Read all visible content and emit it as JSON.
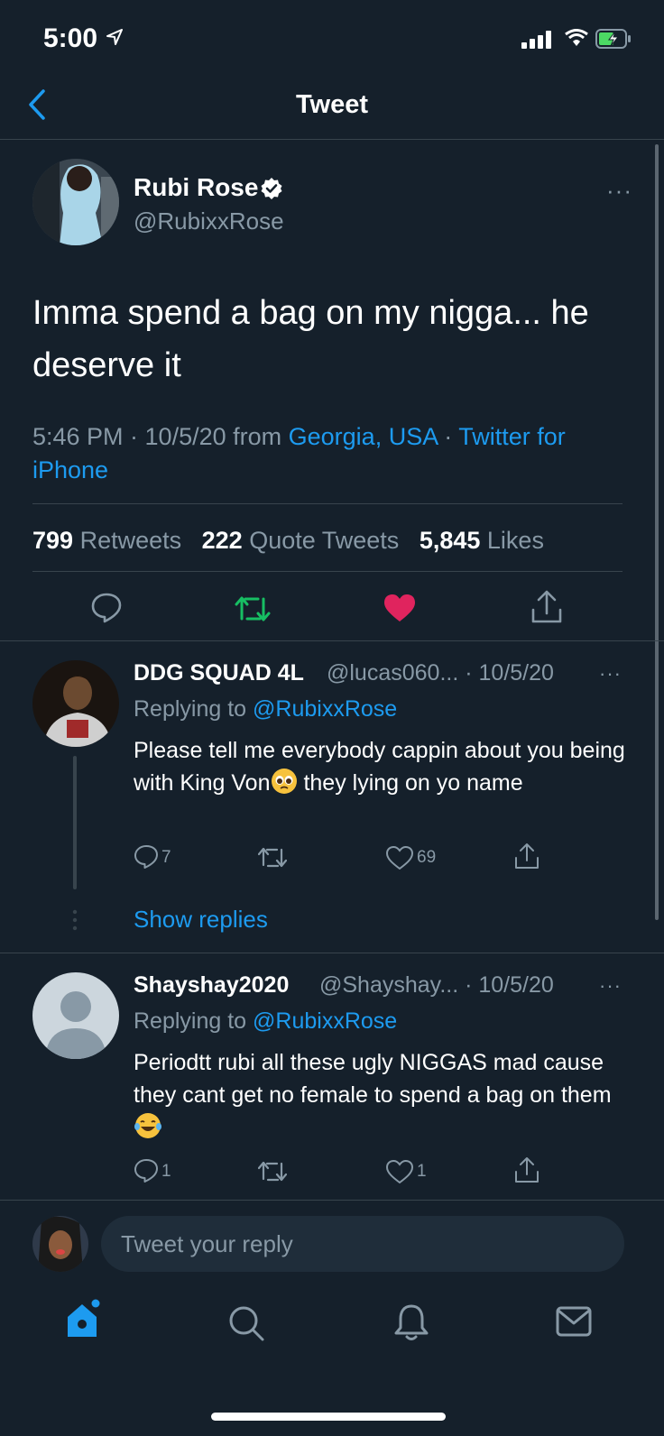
{
  "status_bar": {
    "time": "5:00"
  },
  "header": {
    "title": "Tweet"
  },
  "main_tweet": {
    "name": "Rubi Rose",
    "handle": "@RubixxRose",
    "more": "···",
    "text": "Imma spend a bag on my nigga... he deserve it",
    "time": "5:46 PM · 10/5/20 from ",
    "location": "Georgia, USA",
    "sep": " · ",
    "client": "Twitter for iPhone",
    "retweets_count": "799",
    "retweets_label": " Retweets",
    "quotes_count": "222",
    "quotes_label": " Quote Tweets",
    "likes_count": "5,845",
    "likes_label": " Likes"
  },
  "replies": [
    {
      "name": "DDG SQUAD 4L",
      "handle": "@lucas060... · 10/5/20",
      "replying_prefix": "Replying to ",
      "replying_to": "@RubixxRose",
      "text_a": "Please tell me everybody cappin about you being with King Von",
      "text_b": " they lying on yo name",
      "reply_count": "7",
      "like_count": "69",
      "show_replies": "Show replies"
    },
    {
      "name": "Shayshay2020",
      "handle": "@Shayshay... · 10/5/20",
      "replying_prefix": "Replying to ",
      "replying_to": "@RubixxRose",
      "text": "Periodtt rubi all these ugly NIGGAS mad cause they cant get no female to spend a bag on them ",
      "reply_count": "1",
      "like_count": "1"
    }
  ],
  "reply_bar": {
    "placeholder": "Tweet your reply"
  },
  "colors": {
    "background": "#15202b",
    "accent": "#1d9bf0",
    "retweet": "#17bf63",
    "like": "#e0245e"
  },
  "icons": [
    "location-arrow-icon",
    "signal-icon",
    "wifi-icon",
    "battery-icon",
    "back-chevron-icon",
    "verified-badge-icon",
    "reply-icon",
    "retweet-icon",
    "like-icon",
    "share-icon",
    "home-icon",
    "search-icon",
    "notifications-icon",
    "messages-icon"
  ]
}
